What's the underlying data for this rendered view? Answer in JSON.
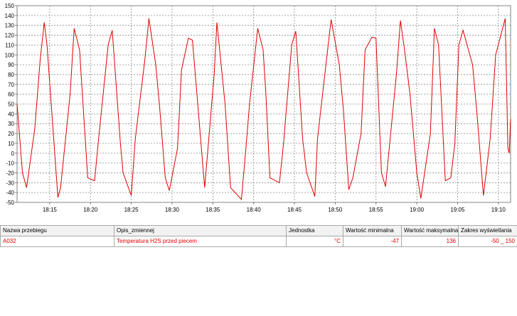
{
  "chart_data": {
    "type": "line",
    "title": "",
    "xlabel": "",
    "ylabel": "",
    "ylim": [
      -50,
      150
    ],
    "yticks": [
      -50,
      -40,
      -30,
      -20,
      -10,
      0,
      10,
      20,
      30,
      40,
      50,
      60,
      70,
      80,
      90,
      100,
      110,
      120,
      130,
      140,
      150
    ],
    "xlim": [
      "18:11:00",
      "19:11:30"
    ],
    "xticks": [
      "18:15",
      "18:20",
      "18:25",
      "18:30",
      "18:35",
      "18:40",
      "18:45",
      "18:50",
      "18:55",
      "19:00",
      "19:05",
      "19:10"
    ],
    "grid": true,
    "line_color": "#e00000",
    "series": [
      {
        "x": [
          "18:11:00",
          "18:11:40",
          "18:12:10",
          "18:13:10",
          "18:13:50",
          "18:14:20",
          "18:14:40",
          "18:16:00",
          "18:16:20",
          "18:17:30",
          "18:18:00",
          "18:18:40",
          "18:19:00",
          "18:19:40",
          "18:20:30",
          "18:21:00",
          "18:22:10",
          "18:22:40",
          "18:23:40",
          "18:24:00",
          "18:25:00",
          "18:25:30",
          "18:26:40",
          "18:27:10",
          "18:28:00",
          "18:28:30",
          "18:29:10",
          "18:29:40",
          "18:30:40",
          "18:31:10",
          "18:32:00",
          "18:32:30",
          "18:34:00",
          "18:35:10",
          "18:35:30",
          "18:36:30",
          "18:37:10",
          "18:38:30",
          "18:39:00",
          "18:39:30",
          "18:40:30",
          "18:41:10",
          "18:41:30",
          "18:42:00",
          "18:43:10",
          "18:43:40",
          "18:44:40",
          "18:45:10",
          "18:46:00",
          "18:46:30",
          "18:47:30",
          "18:47:50",
          "18:49:00",
          "18:49:30",
          "18:50:30",
          "18:51:00",
          "18:51:40",
          "18:52:10",
          "18:53:10",
          "18:53:40",
          "18:54:30",
          "18:55:00",
          "18:55:40",
          "18:56:10",
          "18:57:30",
          "18:58:00",
          "18:58:30",
          "18:59:10",
          "19:00:00",
          "19:00:30",
          "19:01:40",
          "19:02:10",
          "19:02:40",
          "19:03:30",
          "19:04:10",
          "19:04:40",
          "19:05:10",
          "19:05:40",
          "19:06:50",
          "19:07:20",
          "19:08:10",
          "19:08:30",
          "19:09:00",
          "19:09:40",
          "19:10:50",
          "19:11:10",
          "19:11:20",
          "19:11:30"
        ],
        "values": [
          50,
          -20,
          -35,
          25,
          95,
          133,
          110,
          -45,
          -35,
          60,
          127,
          105,
          60,
          -25,
          -28,
          15,
          110,
          125,
          10,
          -20,
          -43,
          15,
          95,
          137,
          90,
          45,
          -25,
          -38,
          5,
          85,
          117,
          115,
          -35,
          80,
          133,
          50,
          -35,
          -47,
          0,
          50,
          127,
          105,
          60,
          -25,
          -30,
          10,
          110,
          124,
          15,
          -20,
          -44,
          15,
          100,
          136,
          90,
          45,
          -37,
          -25,
          20,
          105,
          118,
          117,
          -20,
          -34,
          80,
          135,
          105,
          60,
          -20,
          -46,
          20,
          127,
          110,
          -28,
          -25,
          10,
          110,
          125,
          90,
          45,
          -43,
          -20,
          15,
          100,
          137,
          5,
          0,
          35
        ]
      }
    ]
  },
  "legend_table": {
    "headers": [
      "Nazwa przebiegu",
      "Opis_zmiennej",
      "Jednostka",
      "Wartość minimalna",
      "Wartość maksymalna",
      "Zakres wyświetlania"
    ],
    "row": {
      "name": "A032",
      "description": "Temperatura H2S przed piecem",
      "unit": "°C",
      "min": "-47",
      "max": "136",
      "range": "-50 _ 150"
    }
  }
}
